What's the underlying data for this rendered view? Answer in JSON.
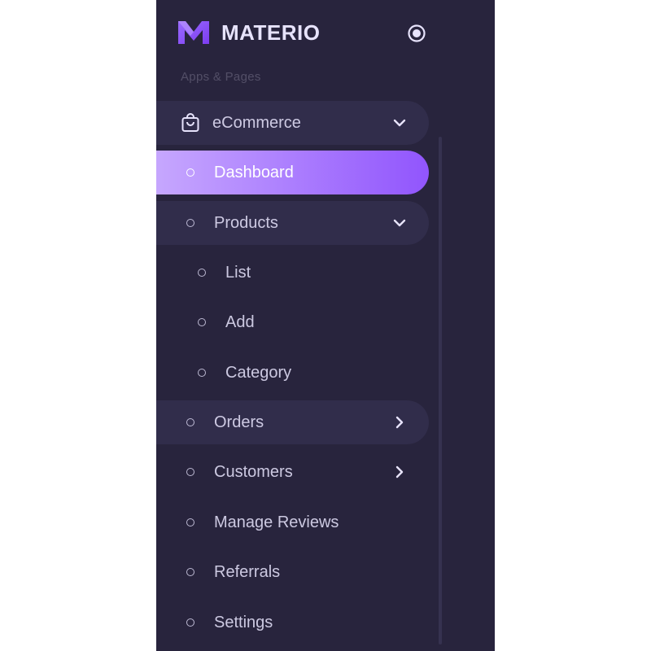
{
  "brand": {
    "name": "MATERIO",
    "logo_icon": "materio-m-logo-icon",
    "accent": "#9155fd"
  },
  "sidebar": {
    "section_header": "Apps & Pages",
    "ecommerce": {
      "label": "eCommerce",
      "icon": "shopping-bag-icon",
      "expanded": true
    },
    "items": {
      "dashboard": {
        "label": "Dashboard",
        "active": true
      },
      "products": {
        "label": "Products",
        "expanded": true
      },
      "list": {
        "label": "List"
      },
      "add": {
        "label": "Add"
      },
      "category": {
        "label": "Category"
      },
      "orders": {
        "label": "Orders"
      },
      "customers": {
        "label": "Customers"
      },
      "reviews": {
        "label": "Manage Reviews"
      },
      "referrals": {
        "label": "Referrals"
      },
      "settings": {
        "label": "Settings"
      }
    }
  },
  "colors": {
    "sidebar_bg": "#28243d",
    "active_gradient_start": "#c6a7fe",
    "active_gradient_end": "#9155fd"
  }
}
